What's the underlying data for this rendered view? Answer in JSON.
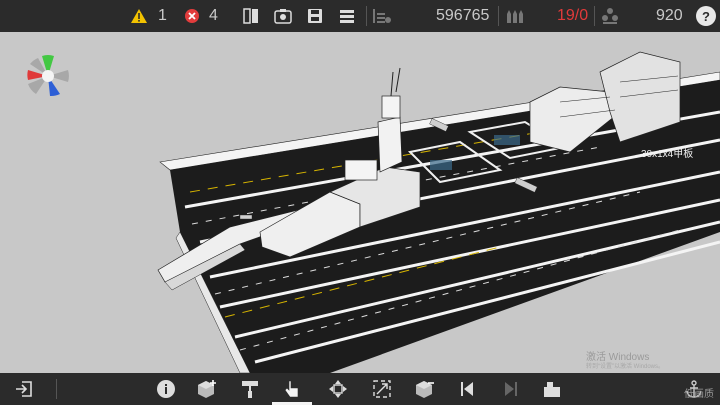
{
  "top": {
    "warning_count": "1",
    "error_count": "4",
    "block_count": "596765",
    "weapon_count": "19/0",
    "crew_count": "920",
    "help_label": "?"
  },
  "viewport": {
    "deck_label": "30x1x4甲板"
  },
  "watermark": {
    "line1": "激活 Windows",
    "line2": "转到“设置”以激活 Windows。"
  },
  "bottom": {
    "right_label": "低画质"
  },
  "colors": {
    "bar": "#2b2b2b",
    "warning": "#f2c200",
    "error": "#e23c3c",
    "weapon_red": "#e03a3a"
  }
}
